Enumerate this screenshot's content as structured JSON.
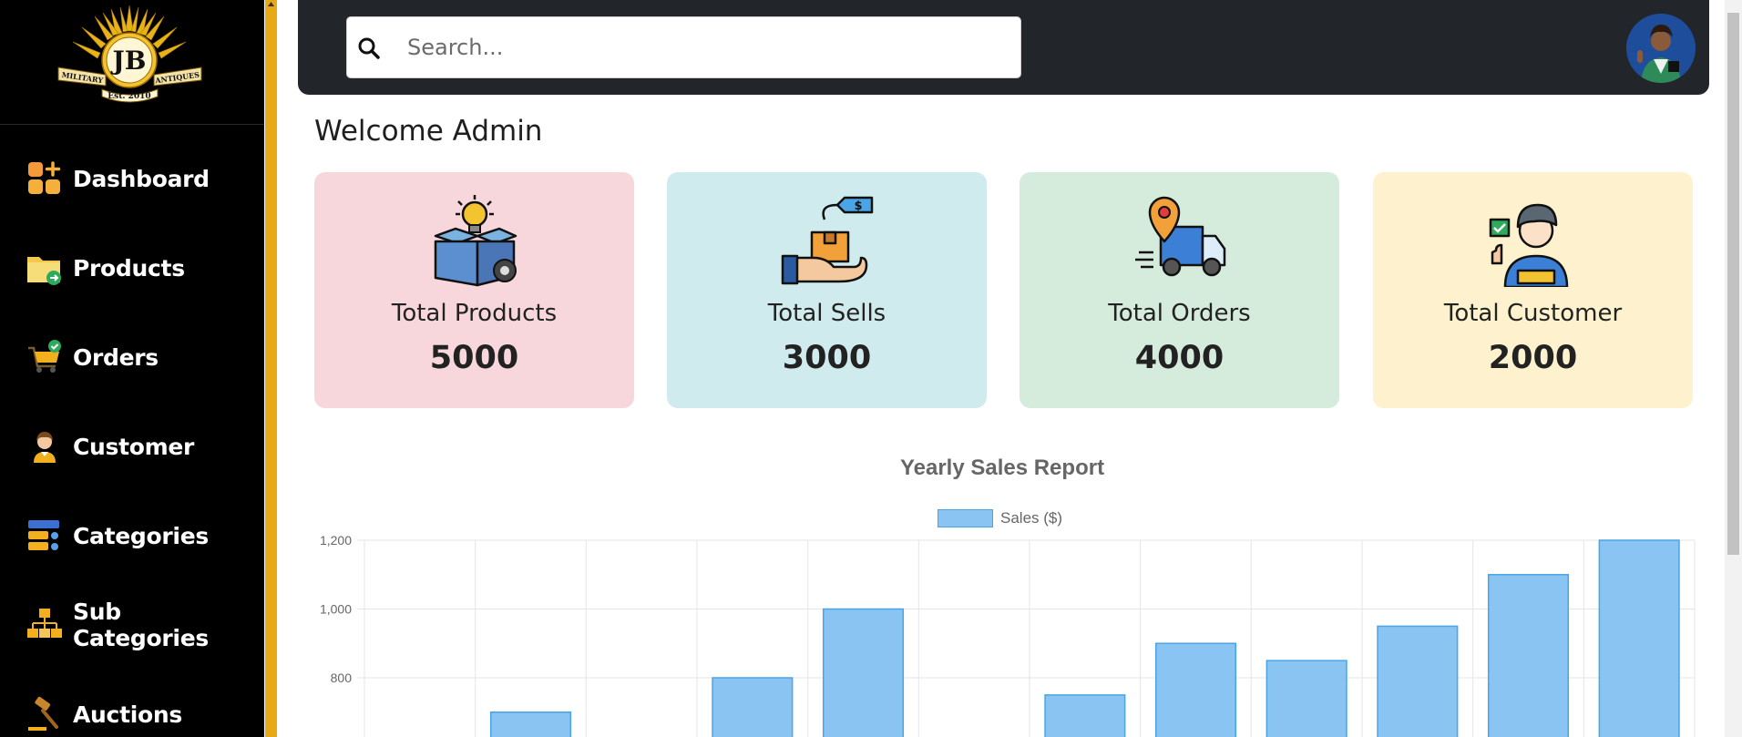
{
  "sidebar": {
    "logo": {
      "top_text": "JB",
      "left_text": "MILITARY",
      "right_text": "ANTIQUES",
      "bottom_text": "Est. 2010"
    },
    "items": [
      {
        "label": "Dashboard",
        "icon": "dashboard-icon"
      },
      {
        "label": "Products",
        "icon": "products-folder-icon"
      },
      {
        "label": "Orders",
        "icon": "orders-cart-icon"
      },
      {
        "label": "Customer",
        "icon": "customer-icon"
      },
      {
        "label": "Categories",
        "icon": "categories-icon"
      },
      {
        "label": "Sub Categories",
        "icon": "sub-categories-icon"
      },
      {
        "label": "Auctions",
        "icon": "auction-gavel-icon"
      }
    ]
  },
  "header": {
    "search": {
      "placeholder": "Search...",
      "value": ""
    }
  },
  "main": {
    "welcome": "Welcome Admin",
    "cards": [
      {
        "title": "Total Products",
        "value": "5000",
        "color": "#f7d7dc",
        "icon": "box-lightbulb-icon"
      },
      {
        "title": "Total Sells",
        "value": "3000",
        "color": "#d0ebee",
        "icon": "hand-box-tag-icon"
      },
      {
        "title": "Total Orders",
        "value": "4000",
        "color": "#d5ecdd",
        "icon": "delivery-truck-icon"
      },
      {
        "title": "Total Customer",
        "value": "2000",
        "color": "#fdf2cd",
        "icon": "customer-person-icon"
      }
    ]
  },
  "colors": {
    "sidebar_bg": "#000000",
    "accent": "#e8a917",
    "topbar_bg": "#22252a",
    "bar_fill": "#89c4f2",
    "bar_stroke": "#4aa4e6"
  },
  "chart_data": {
    "type": "bar",
    "title": "Yearly Sales Report",
    "series": [
      {
        "name": "Sales ($)",
        "values": [
          null,
          700,
          null,
          800,
          1000,
          null,
          750,
          900,
          850,
          950,
          1100,
          1200
        ]
      }
    ],
    "yticks": [
      "1,200",
      "1,000",
      "800"
    ],
    "ylim_visible": [
      700,
      1200
    ],
    "grid": true,
    "legend": "top-center"
  }
}
